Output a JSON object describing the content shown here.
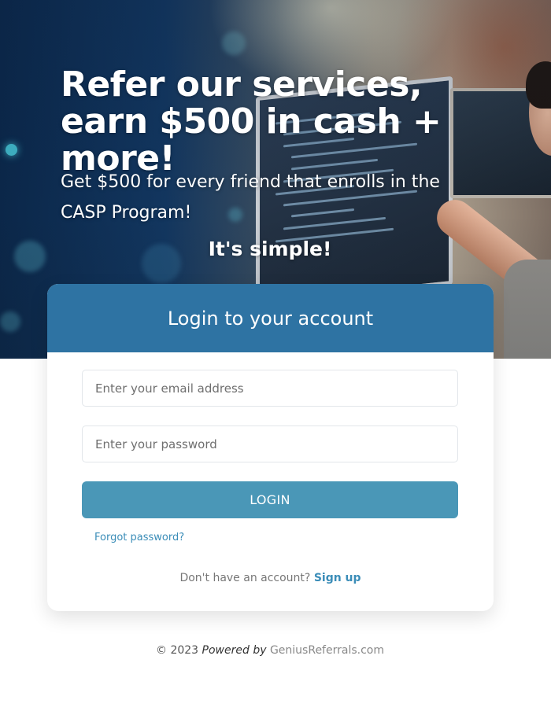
{
  "hero": {
    "title": "Refer our services, earn $500 in cash + more!",
    "subtitle": "Get $500 for every friend that enrolls in the CASP Program!",
    "tagline": "It's simple!"
  },
  "login_card": {
    "header": "Login to your account",
    "email_placeholder": "Enter your email address",
    "password_placeholder": "Enter your password",
    "login_label": "LOGIN",
    "forgot_label": "Forgot password?",
    "signup_prompt": "Don't have an account?",
    "signup_label": "Sign up"
  },
  "footer": {
    "copyright": "© 2023",
    "powered_by": "Powered by",
    "brand": "GeniusReferrals.com"
  },
  "colors": {
    "header_blue": "#2e73a3",
    "button_blue": "#4a97b7",
    "link_blue": "#3b8db8"
  }
}
